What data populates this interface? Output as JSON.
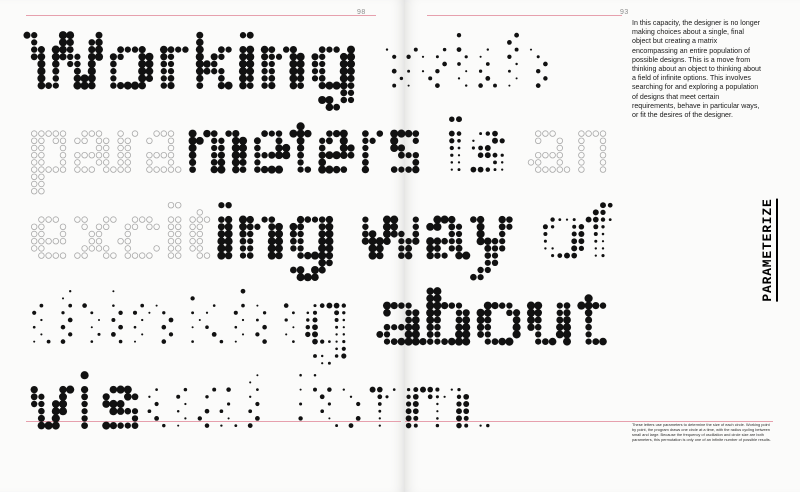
{
  "left_page": {
    "folio": "98",
    "artwork_lines": [
      {
        "segments": [
          {
            "text": "Working",
            "style": "dense"
          },
          {
            "text": " with",
            "style": "sparse"
          }
        ]
      },
      {
        "segments": [
          {
            "text": "para",
            "style": "outline"
          },
          {
            "text": "meters",
            "style": "dense"
          },
          {
            "text": " is ",
            "style": "dotted"
          },
          {
            "text": "an",
            "style": "outline"
          }
        ]
      },
      {
        "segments": [
          {
            "text": "excit",
            "style": "outline"
          },
          {
            "text": "ing way",
            "style": "dense"
          },
          {
            "text": " of",
            "style": "dotted"
          }
        ]
      },
      {
        "segments": [
          {
            "text": "thinkin",
            "style": "sparse"
          },
          {
            "text": "g",
            "style": "dotted"
          },
          {
            "text": " about",
            "style": "dense"
          }
        ]
      },
      {
        "segments": [
          {
            "text": "vis",
            "style": "dense"
          },
          {
            "text": "ual fo",
            "style": "sparse"
          },
          {
            "text": "rm.",
            "style": "dotted"
          }
        ]
      }
    ]
  },
  "right_page": {
    "folio": "93",
    "body_text": "In this capacity, the designer is no longer making choices about a single, final object but creating a matrix encompassing an entire population of possible designs. This is a move from thinking about an object to thinking about a field of infinite options. This involves searching for and exploring a population of designs that meet certain requirements, behave in particular ways, or fit the desires of the designer.",
    "vertical_title": "PARAMETERIZE",
    "caption": "These letters use parameters to determine the size of each circle. Working point by point, the program draws one circle at a time, with the radius cycling between small and large. Because the frequency of oscillation and circle size are both parameters, this permutation is only one of an infinite number of possible results."
  },
  "colors": {
    "paper": "#fbfbfa",
    "ink": "#111111",
    "outline_gray": "#a9a9a9",
    "rule_pink": "#e6a0ad"
  }
}
